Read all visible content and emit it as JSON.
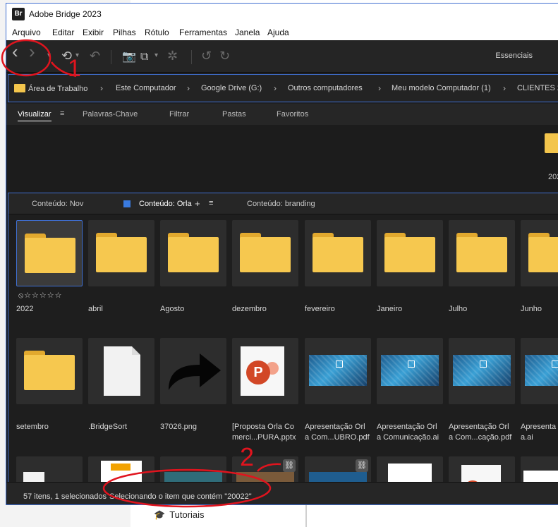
{
  "app": {
    "title": "Adobe Bridge 2023",
    "badge": "Br"
  },
  "menu": [
    "Arquivo",
    "Editar",
    "Exibir",
    "Pilhas",
    "Rótulo",
    "Ferramentas",
    "Janela",
    "Ajuda"
  ],
  "toolbar": {
    "back_icon": "‹",
    "forward_icon": "›",
    "workspace": "Essenciais"
  },
  "breadcrumb": [
    "Área de Trabalho",
    "Este Computador",
    "Google Drive (G:)",
    "Outros computadores",
    "Meu modelo Computador (1)",
    "CLIENTES 2"
  ],
  "panel_tabs": [
    "Visualizar",
    "Palavras-Chave",
    "Filtrar",
    "Pastas",
    "Favoritos"
  ],
  "preview": {
    "label": "202"
  },
  "content_tabs": [
    "Conteúdo: Nov",
    "Conteúdo: Orla",
    "Conteúdo: branding"
  ],
  "items_row1": [
    "2022",
    "abril",
    "Agosto",
    "dezembro",
    "fevereiro",
    "Janeiro",
    "Julho",
    "Junho"
  ],
  "items_row2": [
    [
      "setembro",
      ""
    ],
    [
      ".BridgeSort",
      ""
    ],
    [
      "37026.png",
      ""
    ],
    [
      "[Proposta Orla Co",
      "merci...PURA.pptx"
    ],
    [
      "Apresentação Orl",
      "a Com...UBRO.pdf"
    ],
    [
      "Apresentação Orl",
      "a Comunicação.ai"
    ],
    [
      "Apresentação Orl",
      "a Com...cação.pdf"
    ],
    [
      "Apresenta",
      "a.ai"
    ]
  ],
  "rating": "⦸☆☆☆☆☆",
  "ppt_letter": "P",
  "status": {
    "count": "57 itens, 1 selecionados",
    "message": "Selecionando o item que contém \"20022\""
  },
  "background": {
    "tutorial": "Tutoriais"
  },
  "annotations": {
    "num1": "1",
    "num2": "2"
  },
  "colors": {
    "folder": "#f6c84f",
    "accent": "#3f6fd1",
    "annotation": "#e0141e"
  }
}
